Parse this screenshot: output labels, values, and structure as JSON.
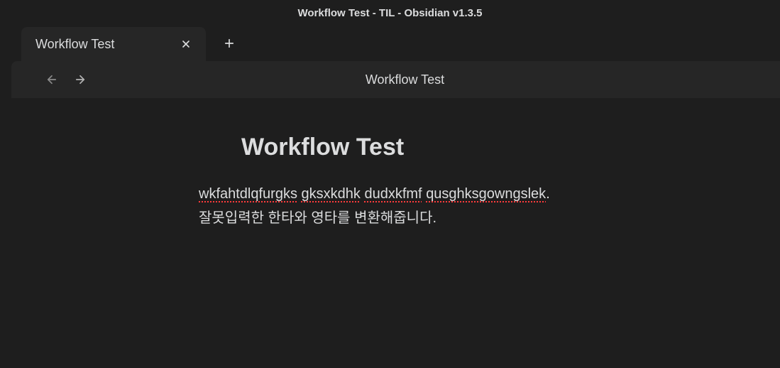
{
  "window": {
    "title": "Workflow Test - TIL - Obsidian v1.3.5"
  },
  "tabs": {
    "active_label": "Workflow Test"
  },
  "view_header": {
    "title": "Workflow Test"
  },
  "note": {
    "title": "Workflow Test",
    "line1_word1": "wkfahtdlqfurgks",
    "line1_word2": "gksxkdhk",
    "line1_word3": "dudxkfmf",
    "line1_word4": "qusghksgowngslek",
    "line1_suffix": ".",
    "line2": "잘못입력한 한타와 영타를 변환해줍니다."
  }
}
